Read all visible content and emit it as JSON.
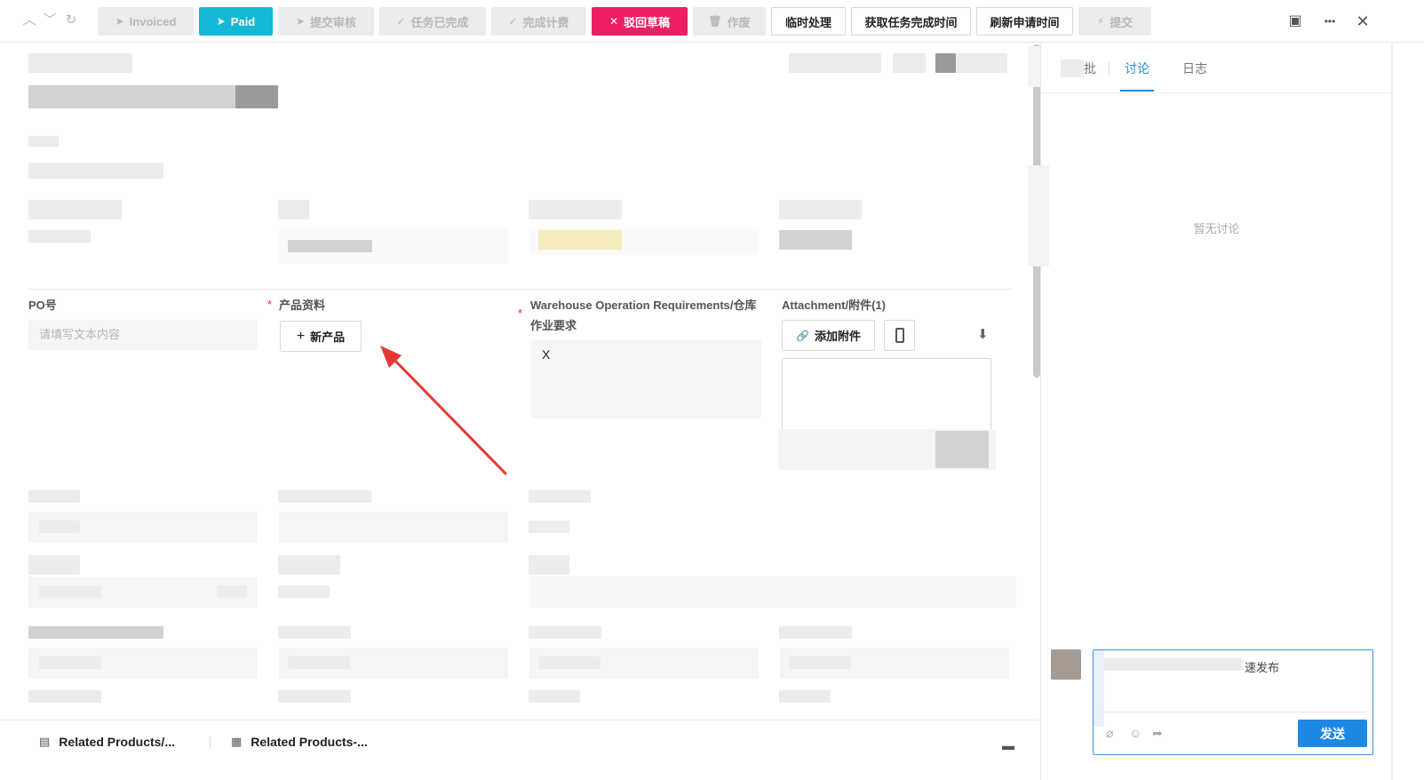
{
  "toolbar": {
    "nav": {
      "up": "︿",
      "down": "﹀",
      "refresh": "↻"
    },
    "buttons": [
      {
        "label": "Invoiced",
        "icon": "➤",
        "state": "disabled"
      },
      {
        "label": "Paid",
        "icon": "➤",
        "state": "primary"
      },
      {
        "label": "提交审核",
        "icon": "➤",
        "state": "disabled"
      },
      {
        "label": "任务已完成",
        "icon": "✓",
        "state": "disabled"
      },
      {
        "label": "完成计费",
        "icon": "✓",
        "state": "disabled"
      },
      {
        "label": "驳回草稿",
        "icon": "✕",
        "state": "danger"
      },
      {
        "label": "作废",
        "icon": "🗑",
        "state": "disabled"
      },
      {
        "label": "临时处理",
        "icon": "",
        "state": "outline"
      },
      {
        "label": "获取任务完成时间",
        "icon": "",
        "state": "outline"
      },
      {
        "label": "刷新申请时间",
        "icon": "",
        "state": "outline"
      },
      {
        "label": "提交",
        "icon": "⚡",
        "state": "disabled"
      }
    ],
    "window": {
      "sidebar_toggle": "▣",
      "more": "•••",
      "close": "✕"
    },
    "colors": {
      "primary": "#13b8d4",
      "danger": "#ec1f63"
    }
  },
  "form": {
    "po": {
      "label": "PO号",
      "placeholder": "请填写文本内容"
    },
    "product": {
      "label": "产品资料",
      "required": "*",
      "add_button": "新产品",
      "add_icon": "+"
    },
    "warehouse": {
      "label_line1": "Warehouse Operation Requirements/仓库",
      "label_line2": "作业要求",
      "required": "*",
      "value": "X"
    },
    "attachment": {
      "label": "Attachment/附件(1)",
      "add_button": "添加附件",
      "link_icon": "🔗",
      "phone_icon": "📱",
      "download_icon": "⬇"
    }
  },
  "bottom_tabs": [
    {
      "label": "Related Products/...",
      "icon": "▤"
    },
    {
      "label": "Related Products-...",
      "icon": "▦"
    }
  ],
  "bottom_panel_icon": "▬",
  "right_panel": {
    "tabs": [
      {
        "label": "批",
        "active": false
      },
      {
        "label": "讨论",
        "active": true
      },
      {
        "label": "日志",
        "active": false
      }
    ],
    "empty_message": "暂无讨论",
    "comment": {
      "text_visible": "速发布",
      "send_label": "发送",
      "icons": {
        "attach": "⌀",
        "emoji": "☺",
        "share": "➦"
      }
    },
    "accent": "#1e88e5"
  }
}
